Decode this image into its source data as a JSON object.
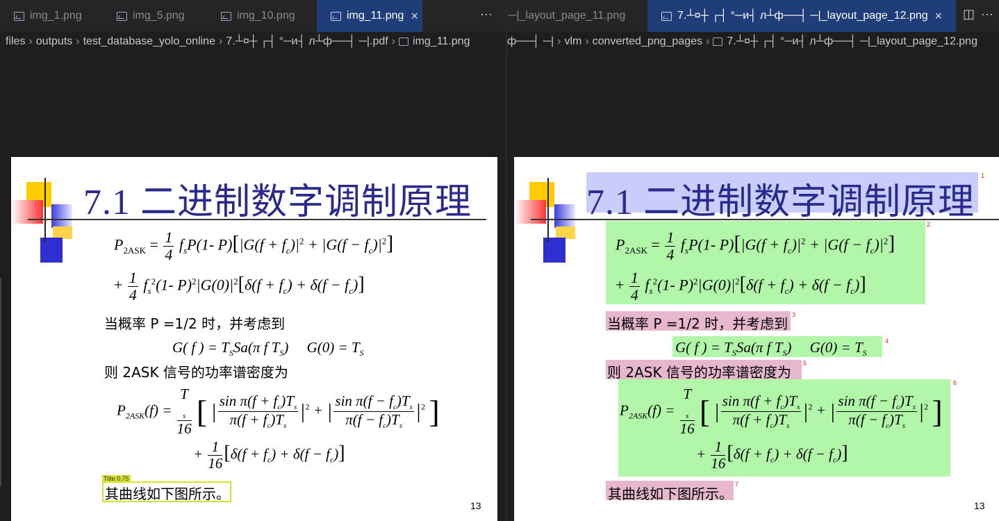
{
  "left_tabs": [
    {
      "label": "img_1.png",
      "active": false
    },
    {
      "label": "img_5.png",
      "active": false
    },
    {
      "label": "img_10.png",
      "active": false
    },
    {
      "label": "img_11.png",
      "active": true
    }
  ],
  "left_more": "···",
  "right_tabs": [
    {
      "label": "─|_layout_page_11.png",
      "active": false
    },
    {
      "label": "7.┴¤┼ ┌┤ °─и┤ л┴ф──┤ ─|_layout_page_12.png",
      "active": true
    }
  ],
  "right_more": "···",
  "left_breadcrumb": [
    "files",
    "outputs",
    "test_database_yolo_online",
    "7.┴¤┼ ┌┤ °─и┤ л┴ф──┤ ─|.pdf",
    "img_11.png"
  ],
  "right_breadcrumb": [
    "ф──┤ ─|",
    "vlm",
    "converted_png_pages",
    "7.┴¤┼ ┌┤ °─и┤ л┴ф──┤ ─|_layout_page_12.png"
  ],
  "slide": {
    "title": "7.1  二进制数字调制原理",
    "text1": "当概率 P =1/2 时，并考虑到",
    "text2": "则 2ASK 信号的功率谱密度为",
    "text3": "其曲线如下图所示。",
    "page_number": "13",
    "eq1a_lhs": "P",
    "eq1a_sub": "2ASK",
    "eq1a_mid": "f",
    "eq1a_body": "P(1- P)",
    "eq1a_bracket": "G(f + f",
    "eq1b_lead": "+",
    "eq1b_body": "(1- P)",
    "eq3_lhs": "P",
    "eq3_sub": "2ASK",
    "frac_1": "1",
    "frac_4": "4",
    "frac_16": "16",
    "frac_Ts": "T",
    "eq2_g": "G( f ) = T",
    "eq2_sa": "Sa(π f T",
    "eq2_g0": "G(0) = T"
  },
  "left_annotation": {
    "label": "Title 0.75"
  },
  "right_annotations": [
    "1",
    "2",
    "3",
    "4",
    "5",
    "6",
    "7"
  ]
}
